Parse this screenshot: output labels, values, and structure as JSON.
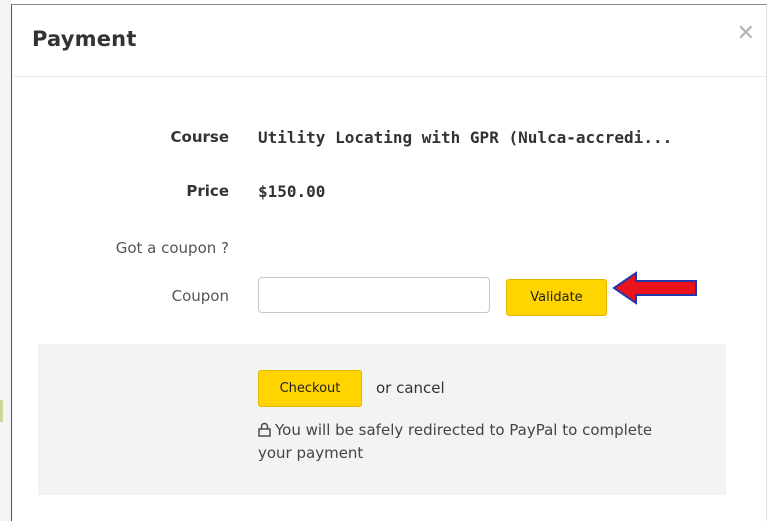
{
  "modal": {
    "title": "Payment",
    "close_icon": "close-icon"
  },
  "details": {
    "course_label": "Course",
    "course_value": "Utility Locating with GPR (Nulca-accredi...",
    "price_label": "Price",
    "price_value": "$150.00",
    "coupon_prompt": "Got a coupon ?",
    "coupon_label": "Coupon",
    "coupon_value": "",
    "coupon_placeholder": "",
    "validate_label": "Validate"
  },
  "footer": {
    "checkout_label": "Checkout",
    "cancel_text": "or cancel",
    "note_icon": "lock-icon",
    "note_text": "You will be safely redirected to PayPal to complete your payment"
  },
  "colors": {
    "button": "#ffd400",
    "arrow": "#e8131b",
    "arrow_outline": "#2436a8",
    "footer_bg": "#f3f3f3"
  }
}
